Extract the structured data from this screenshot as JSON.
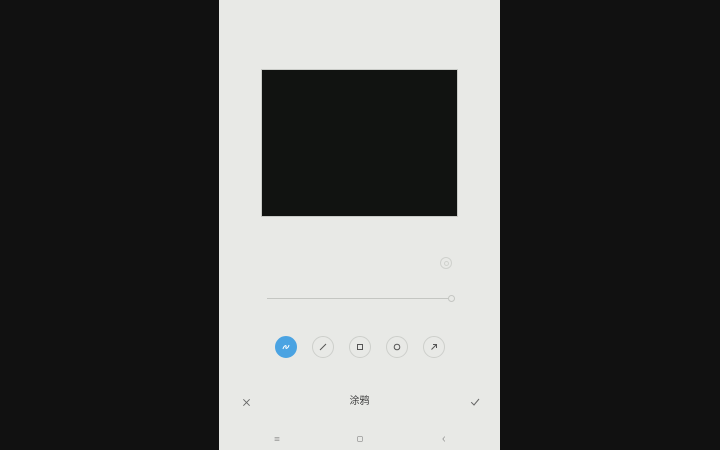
{
  "editor": {
    "title": "涂鸦"
  },
  "tools": [
    {
      "icon": "pen-icon",
      "active": true
    },
    {
      "icon": "line-icon",
      "active": false
    },
    {
      "icon": "rectangle-icon",
      "active": false
    },
    {
      "icon": "circle-icon",
      "active": false
    },
    {
      "icon": "arrow-icon",
      "active": false
    }
  ],
  "bottom_bar": {
    "cancel_icon": "close-icon",
    "confirm_icon": "checkmark-icon"
  },
  "nav_bar": {
    "items": [
      "menu-icon",
      "home-icon",
      "back-icon"
    ]
  },
  "colors": {
    "accent": "#4aa3e2",
    "background": "#e8e9e6",
    "canvas": "#111311"
  }
}
